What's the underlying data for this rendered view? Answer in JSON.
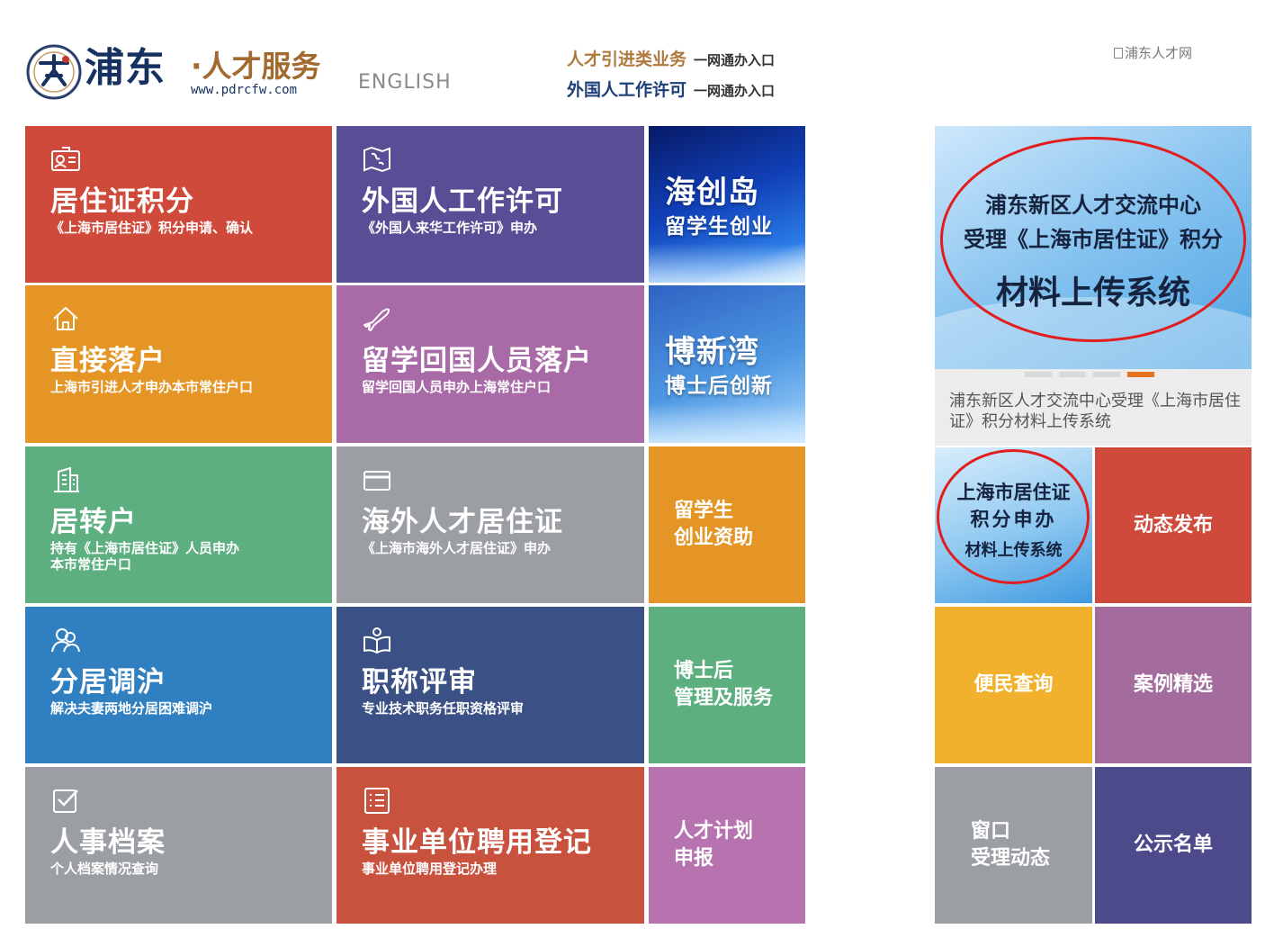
{
  "header": {
    "logo_brand": "浦东",
    "logo_sub": "·人才服务",
    "logo_url": "www.pdrcfw.com",
    "english_link": "ENGLISH",
    "portal_links": [
      {
        "label": "人才引进类业务",
        "tail": "一网通办入口"
      },
      {
        "label": "外国人工作许可",
        "tail": "一网通办入口"
      }
    ],
    "site_breadcrumb": "浦东人才网"
  },
  "tiles": [
    {
      "title": "居住证积分",
      "desc": "《上海市居住证》积分申请、确认",
      "icon": "id-card-icon",
      "color": "#cf4a3b"
    },
    {
      "title": "外国人工作许可",
      "desc": "《外国人来华工作许可》申办",
      "icon": "world-map-icon",
      "color": "#574e96"
    },
    {
      "title": "直接落户",
      "desc": "上海市引进人才申办本市常住户口",
      "icon": "home-icon",
      "color": "#e49526"
    },
    {
      "title": "留学回国人员落户",
      "desc": "留学回国人员申办上海常住户口",
      "icon": "airplane-icon",
      "color": "#a96ba7"
    },
    {
      "title": "居转户",
      "desc_line1": "持有《上海市居住证》人员申办",
      "desc_line2": "本市常住户口",
      "icon": "building-icon",
      "color": "#5daf7f"
    },
    {
      "title": "海外人才居住证",
      "desc": "《上海市海外人才居住证》申办",
      "icon": "card-icon",
      "color": "#9b9ea3"
    },
    {
      "title": "分居调沪",
      "desc": "解决夫妻两地分居困难调沪",
      "icon": "couple-icon",
      "color": "#2f7fc1"
    },
    {
      "title": "职称评审",
      "desc": "专业技术职务任职资格评审",
      "icon": "reader-book-icon",
      "color": "#3b5185"
    },
    {
      "title": "人事档案",
      "desc": "个人档案情况查询",
      "icon": "checkbox-icon",
      "color": "#9b9ea3"
    },
    {
      "title": "事业单位聘用登记",
      "desc": "事业单位聘用登记办理",
      "icon": "list-icon",
      "color": "#c9523f"
    }
  ],
  "banners": [
    {
      "title": "海创岛",
      "subtitle": "留学生创业"
    },
    {
      "title": "博新湾",
      "subtitle": "博士后创新"
    }
  ],
  "side_tiles": [
    {
      "line1": "留学生",
      "line2": "创业资助",
      "color": "#e49526"
    },
    {
      "line1": "博士后",
      "line2": "管理及服务",
      "color": "#5daf7f"
    },
    {
      "line1": "人才计划",
      "line2": "申报",
      "color": "#b773b0"
    }
  ],
  "slider": {
    "line1": "浦东新区人才交流中心",
    "line2": "受理《上海市居住证》积分",
    "line3": "材料上传系统",
    "caption": "浦东新区人才交流中心受理《上海市居住证》积分材料上传系统",
    "active_dot": 4,
    "dot_count": 4
  },
  "promo": {
    "line1": "上海市居住证",
    "line2": "积分申办",
    "line3": "材料上传系统"
  },
  "right_tiles": [
    {
      "label": "动态发布",
      "color": "#cf4a3b"
    },
    {
      "label": "便民查询",
      "color": "#f2b12c"
    },
    {
      "label": "案例精选",
      "color": "#a46b9d"
    },
    {
      "line1": "窗口",
      "line2": "受理动态",
      "color": "#9b9ea3"
    },
    {
      "label": "公示名单",
      "color": "#4d4a8b"
    }
  ]
}
